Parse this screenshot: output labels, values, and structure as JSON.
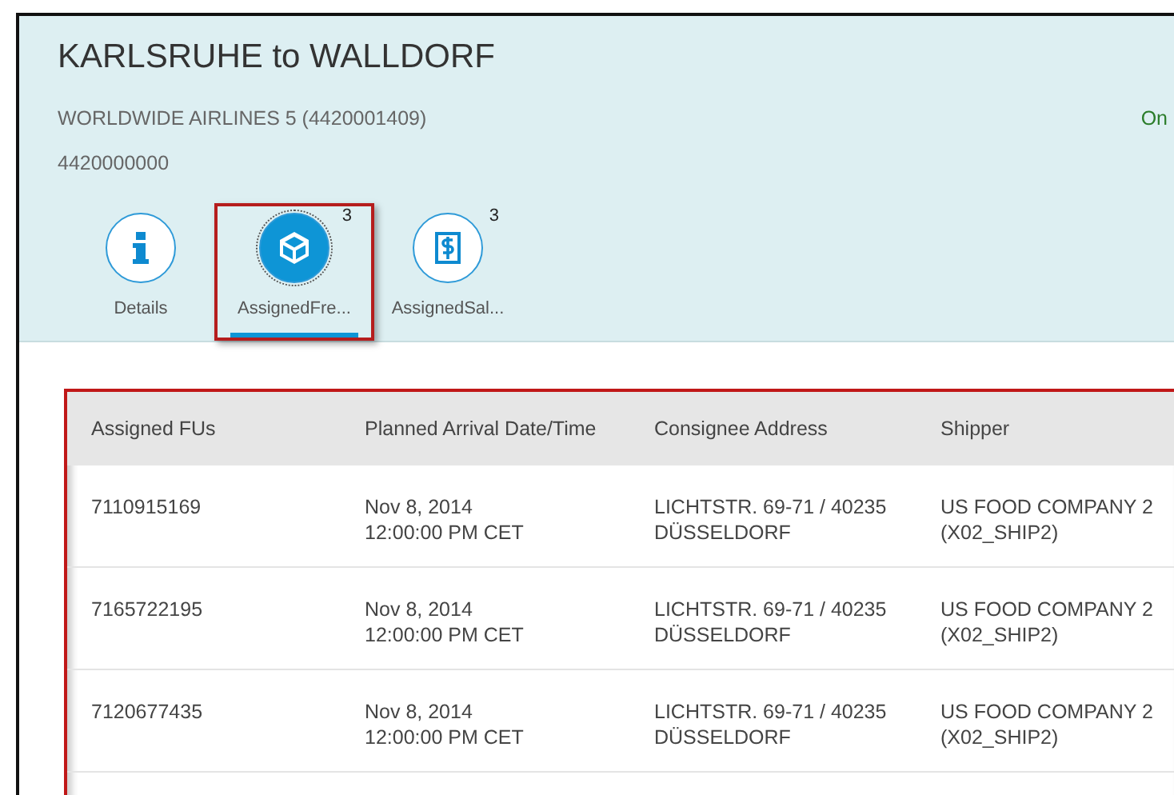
{
  "header": {
    "title": "KARLSRUHE to WALLDORF",
    "carrier": "WORLDWIDE AIRLINES 5 (4420001409)",
    "status": "On",
    "number": "4420000000"
  },
  "tabs": [
    {
      "label": "Details",
      "kind": "info",
      "selected": false
    },
    {
      "label": "AssignedFre...",
      "kind": "box",
      "count": "3",
      "selected": true,
      "highlighted": true
    },
    {
      "label": "AssignedSal...",
      "kind": "invoice",
      "count": "3",
      "selected": false
    }
  ],
  "table": {
    "highlighted": true,
    "columns": [
      "Assigned FUs",
      "Planned Arrival Date/Time",
      "Consignee Address",
      "Shipper"
    ],
    "rows": [
      {
        "cells": [
          "7110915169",
          [
            "Nov 8, 2014",
            "12:00:00 PM CET"
          ],
          [
            "LICHTSTR. 69-71 / 40235",
            "DÜSSELDORF"
          ],
          [
            "US FOOD COMPANY 2",
            "(X02_SHIP2)"
          ]
        ]
      },
      {
        "cells": [
          "7165722195",
          [
            "Nov 8, 2014",
            "12:00:00 PM CET"
          ],
          [
            "LICHTSTR. 69-71 / 40235",
            "DÜSSELDORF"
          ],
          [
            "US FOOD COMPANY 2",
            "(X02_SHIP2)"
          ]
        ]
      },
      {
        "cells": [
          "7120677435",
          [
            "Nov 8, 2014",
            "12:00:00 PM CET"
          ],
          [
            "LICHTSTR. 69-71 / 40235",
            "DÜSSELDORF"
          ],
          [
            "US FOOD COMPANY 2",
            "(X02_SHIP2)"
          ]
        ]
      }
    ]
  }
}
